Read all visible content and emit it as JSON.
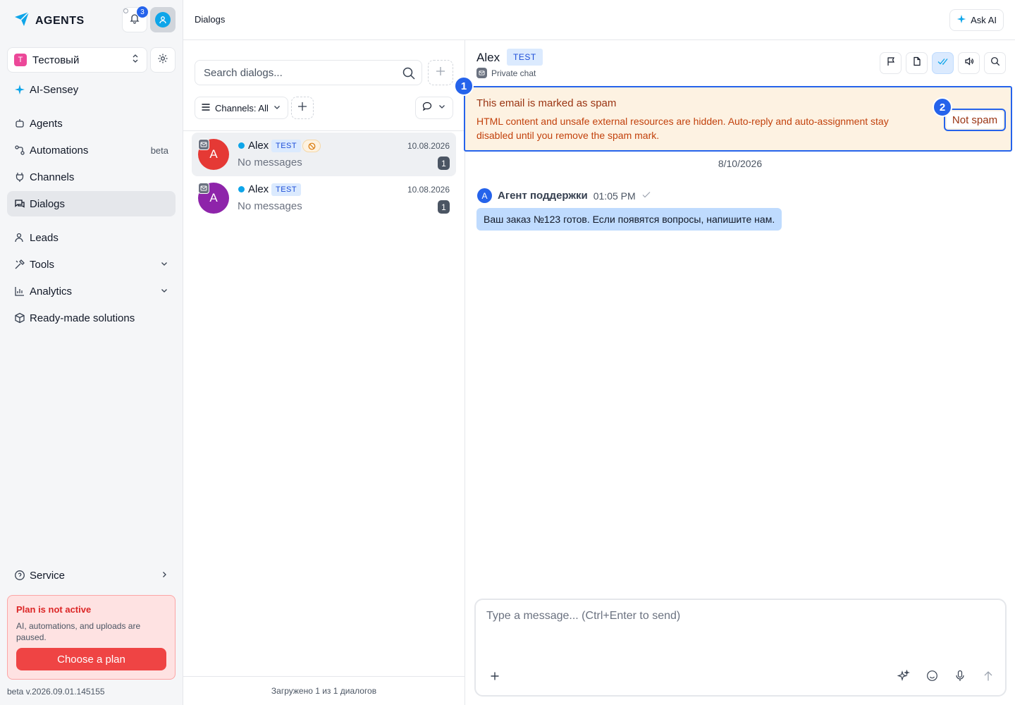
{
  "brand": {
    "name": "AGENTS"
  },
  "notifications": {
    "count": "3"
  },
  "workspace": {
    "initial": "Т",
    "name": "Тестовый"
  },
  "sidebar": {
    "ai_item": "AI-Sensey",
    "items": [
      {
        "label": "Agents"
      },
      {
        "label": "Automations",
        "tail": "beta"
      },
      {
        "label": "Channels"
      },
      {
        "label": "Dialogs"
      },
      {
        "label": "Leads"
      },
      {
        "label": "Tools"
      },
      {
        "label": "Analytics"
      },
      {
        "label": "Ready-made solutions"
      }
    ],
    "service": "Service"
  },
  "plan": {
    "title": "Plan is not active",
    "description": "AI, automations, and uploads are paused.",
    "button": "Choose a plan"
  },
  "version": "beta v.2026.09.01.145155",
  "topbar": {
    "title": "Dialogs",
    "ask_ai": "Ask AI"
  },
  "dialog_list": {
    "search_placeholder": "Search dialogs...",
    "channels_filter": "Channels: All",
    "footer": "Загружено 1 из 1 диалогов",
    "items": [
      {
        "initial": "A",
        "name": "Alex",
        "tag": "TEST",
        "date": "10.08.2026",
        "preview": "No messages",
        "count": "1",
        "avatar_color": "#e53935",
        "spam": true
      },
      {
        "initial": "A",
        "name": "Alex",
        "tag": "TEST",
        "date": "10.08.2026",
        "preview": "No messages",
        "count": "1",
        "avatar_color": "#8e24aa",
        "spam": false
      }
    ]
  },
  "chat": {
    "title": "Alex",
    "tag": "TEST",
    "subtitle": "Private chat",
    "spam_banner": {
      "title": "This email is marked as spam",
      "text": "HTML content and unsafe external resources are hidden. Auto-reply and auto-assignment stay disabled until you remove the spam mark.",
      "button": "Not spam"
    },
    "markers": [
      "1",
      "2"
    ],
    "date_separator": "8/10/2026",
    "message": {
      "author_initial": "A",
      "author": "Агент поддержки",
      "time": "01:05 PM",
      "text": "Ваш заказ №123 готов. Если появятся вопросы, напишите нам."
    },
    "composer_placeholder": "Type a message... (Ctrl+Enter to send)"
  },
  "colors": {
    "accent": "#2563eb",
    "danger": "#ef4444",
    "spam_bg": "#fdf2e2",
    "tag_bg": "#dbeafe"
  },
  "icons": [
    "bell-icon",
    "user-icon",
    "settings-icon",
    "sparkle-icon",
    "robot-icon",
    "automation-icon",
    "plug-icon",
    "chat-icon",
    "people-icon",
    "tools-icon",
    "chart-icon",
    "box-icon",
    "help-icon",
    "search-icon",
    "plus-icon",
    "list-icon",
    "chevron-down-icon",
    "flag-icon",
    "file-icon",
    "double-check-icon",
    "speaker-icon",
    "mail-icon",
    "ban-icon",
    "emoji-icon",
    "mic-icon",
    "arrow-up-icon"
  ]
}
